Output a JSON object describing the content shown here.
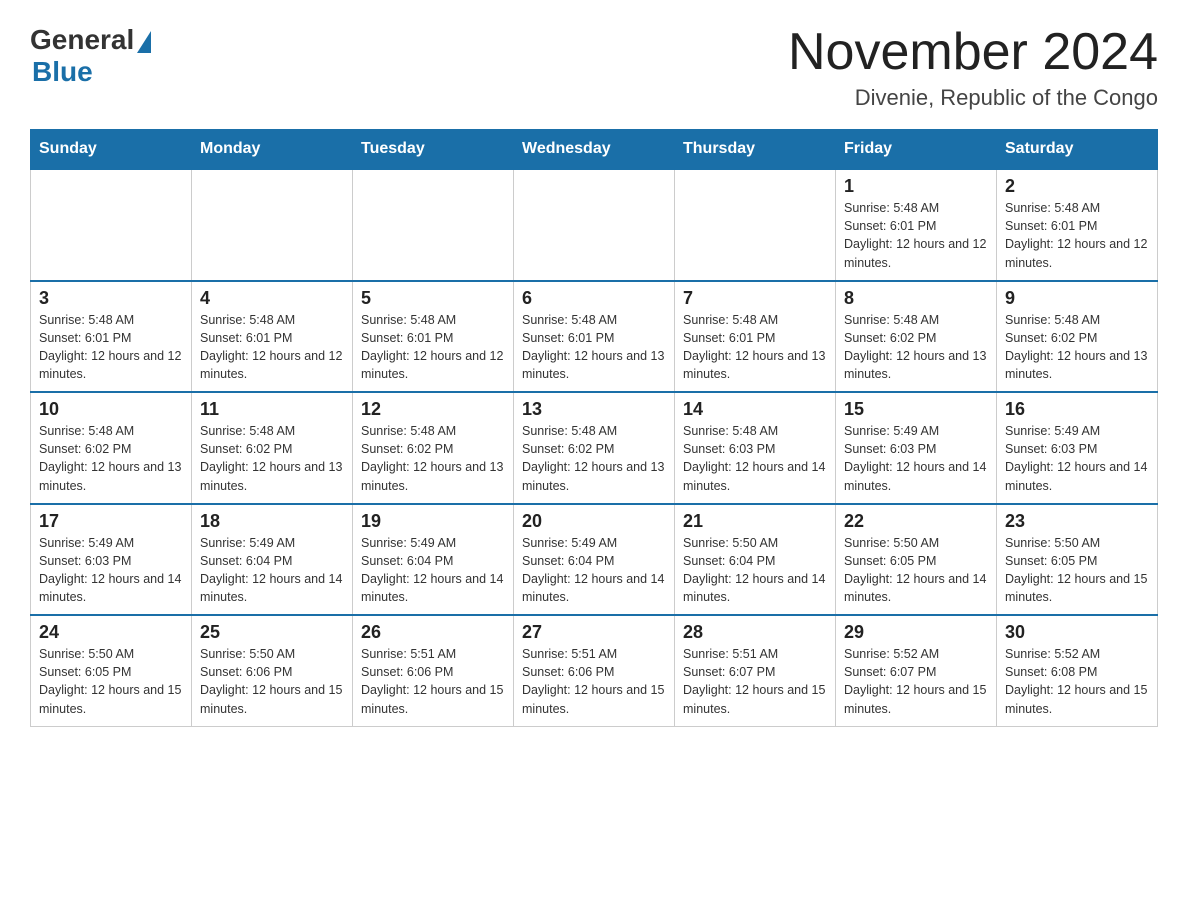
{
  "header": {
    "logo_general": "General",
    "logo_blue": "Blue",
    "month_title": "November 2024",
    "location": "Divenie, Republic of the Congo"
  },
  "columns": [
    "Sunday",
    "Monday",
    "Tuesday",
    "Wednesday",
    "Thursday",
    "Friday",
    "Saturday"
  ],
  "weeks": [
    [
      {
        "day": "",
        "sunrise": "",
        "sunset": "",
        "daylight": ""
      },
      {
        "day": "",
        "sunrise": "",
        "sunset": "",
        "daylight": ""
      },
      {
        "day": "",
        "sunrise": "",
        "sunset": "",
        "daylight": ""
      },
      {
        "day": "",
        "sunrise": "",
        "sunset": "",
        "daylight": ""
      },
      {
        "day": "",
        "sunrise": "",
        "sunset": "",
        "daylight": ""
      },
      {
        "day": "1",
        "sunrise": "Sunrise: 5:48 AM",
        "sunset": "Sunset: 6:01 PM",
        "daylight": "Daylight: 12 hours and 12 minutes."
      },
      {
        "day": "2",
        "sunrise": "Sunrise: 5:48 AM",
        "sunset": "Sunset: 6:01 PM",
        "daylight": "Daylight: 12 hours and 12 minutes."
      }
    ],
    [
      {
        "day": "3",
        "sunrise": "Sunrise: 5:48 AM",
        "sunset": "Sunset: 6:01 PM",
        "daylight": "Daylight: 12 hours and 12 minutes."
      },
      {
        "day": "4",
        "sunrise": "Sunrise: 5:48 AM",
        "sunset": "Sunset: 6:01 PM",
        "daylight": "Daylight: 12 hours and 12 minutes."
      },
      {
        "day": "5",
        "sunrise": "Sunrise: 5:48 AM",
        "sunset": "Sunset: 6:01 PM",
        "daylight": "Daylight: 12 hours and 12 minutes."
      },
      {
        "day": "6",
        "sunrise": "Sunrise: 5:48 AM",
        "sunset": "Sunset: 6:01 PM",
        "daylight": "Daylight: 12 hours and 13 minutes."
      },
      {
        "day": "7",
        "sunrise": "Sunrise: 5:48 AM",
        "sunset": "Sunset: 6:01 PM",
        "daylight": "Daylight: 12 hours and 13 minutes."
      },
      {
        "day": "8",
        "sunrise": "Sunrise: 5:48 AM",
        "sunset": "Sunset: 6:02 PM",
        "daylight": "Daylight: 12 hours and 13 minutes."
      },
      {
        "day": "9",
        "sunrise": "Sunrise: 5:48 AM",
        "sunset": "Sunset: 6:02 PM",
        "daylight": "Daylight: 12 hours and 13 minutes."
      }
    ],
    [
      {
        "day": "10",
        "sunrise": "Sunrise: 5:48 AM",
        "sunset": "Sunset: 6:02 PM",
        "daylight": "Daylight: 12 hours and 13 minutes."
      },
      {
        "day": "11",
        "sunrise": "Sunrise: 5:48 AM",
        "sunset": "Sunset: 6:02 PM",
        "daylight": "Daylight: 12 hours and 13 minutes."
      },
      {
        "day": "12",
        "sunrise": "Sunrise: 5:48 AM",
        "sunset": "Sunset: 6:02 PM",
        "daylight": "Daylight: 12 hours and 13 minutes."
      },
      {
        "day": "13",
        "sunrise": "Sunrise: 5:48 AM",
        "sunset": "Sunset: 6:02 PM",
        "daylight": "Daylight: 12 hours and 13 minutes."
      },
      {
        "day": "14",
        "sunrise": "Sunrise: 5:48 AM",
        "sunset": "Sunset: 6:03 PM",
        "daylight": "Daylight: 12 hours and 14 minutes."
      },
      {
        "day": "15",
        "sunrise": "Sunrise: 5:49 AM",
        "sunset": "Sunset: 6:03 PM",
        "daylight": "Daylight: 12 hours and 14 minutes."
      },
      {
        "day": "16",
        "sunrise": "Sunrise: 5:49 AM",
        "sunset": "Sunset: 6:03 PM",
        "daylight": "Daylight: 12 hours and 14 minutes."
      }
    ],
    [
      {
        "day": "17",
        "sunrise": "Sunrise: 5:49 AM",
        "sunset": "Sunset: 6:03 PM",
        "daylight": "Daylight: 12 hours and 14 minutes."
      },
      {
        "day": "18",
        "sunrise": "Sunrise: 5:49 AM",
        "sunset": "Sunset: 6:04 PM",
        "daylight": "Daylight: 12 hours and 14 minutes."
      },
      {
        "day": "19",
        "sunrise": "Sunrise: 5:49 AM",
        "sunset": "Sunset: 6:04 PM",
        "daylight": "Daylight: 12 hours and 14 minutes."
      },
      {
        "day": "20",
        "sunrise": "Sunrise: 5:49 AM",
        "sunset": "Sunset: 6:04 PM",
        "daylight": "Daylight: 12 hours and 14 minutes."
      },
      {
        "day": "21",
        "sunrise": "Sunrise: 5:50 AM",
        "sunset": "Sunset: 6:04 PM",
        "daylight": "Daylight: 12 hours and 14 minutes."
      },
      {
        "day": "22",
        "sunrise": "Sunrise: 5:50 AM",
        "sunset": "Sunset: 6:05 PM",
        "daylight": "Daylight: 12 hours and 14 minutes."
      },
      {
        "day": "23",
        "sunrise": "Sunrise: 5:50 AM",
        "sunset": "Sunset: 6:05 PM",
        "daylight": "Daylight: 12 hours and 15 minutes."
      }
    ],
    [
      {
        "day": "24",
        "sunrise": "Sunrise: 5:50 AM",
        "sunset": "Sunset: 6:05 PM",
        "daylight": "Daylight: 12 hours and 15 minutes."
      },
      {
        "day": "25",
        "sunrise": "Sunrise: 5:50 AM",
        "sunset": "Sunset: 6:06 PM",
        "daylight": "Daylight: 12 hours and 15 minutes."
      },
      {
        "day": "26",
        "sunrise": "Sunrise: 5:51 AM",
        "sunset": "Sunset: 6:06 PM",
        "daylight": "Daylight: 12 hours and 15 minutes."
      },
      {
        "day": "27",
        "sunrise": "Sunrise: 5:51 AM",
        "sunset": "Sunset: 6:06 PM",
        "daylight": "Daylight: 12 hours and 15 minutes."
      },
      {
        "day": "28",
        "sunrise": "Sunrise: 5:51 AM",
        "sunset": "Sunset: 6:07 PM",
        "daylight": "Daylight: 12 hours and 15 minutes."
      },
      {
        "day": "29",
        "sunrise": "Sunrise: 5:52 AM",
        "sunset": "Sunset: 6:07 PM",
        "daylight": "Daylight: 12 hours and 15 minutes."
      },
      {
        "day": "30",
        "sunrise": "Sunrise: 5:52 AM",
        "sunset": "Sunset: 6:08 PM",
        "daylight": "Daylight: 12 hours and 15 minutes."
      }
    ]
  ]
}
